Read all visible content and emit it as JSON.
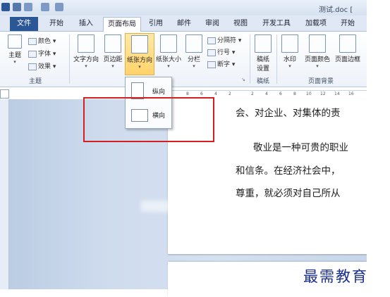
{
  "title_bar": {
    "doc_title": "测试.doc ["
  },
  "tabs": [
    "文件",
    "开始",
    "插入",
    "页面布局",
    "引用",
    "邮件",
    "审阅",
    "视图",
    "开发工具",
    "加载项",
    "开始"
  ],
  "active_tab": "页面布局",
  "ribbon": {
    "theme_group": {
      "label": "主题",
      "theme_button": "主题",
      "colors": "颜色",
      "fonts": "字体",
      "effects": "效果"
    },
    "page_setup": {
      "text_direction": "文字方向",
      "margins": "页边距",
      "orientation": "纸张方向",
      "size": "纸张大小",
      "columns": "分栏",
      "breaks": "分隔符",
      "line_numbers": "行号",
      "hyphenation": "断字"
    },
    "manuscript_group": {
      "label": "稿纸",
      "button_line1": "稿纸",
      "button_line2": "设置"
    },
    "page_background": {
      "label": "页面背景",
      "watermark": "水印",
      "page_color": "页面颜色",
      "page_borders": "页面边框"
    }
  },
  "orientation_menu": {
    "portrait": "纵向",
    "landscape": "横向"
  },
  "ruler_ticks": [
    "8",
    "6",
    "4",
    "2",
    "2",
    "4",
    "6",
    "8",
    "10",
    "12",
    "14",
    "16"
  ],
  "document_lines": [
    "会、对企业、对集体的责",
    "敬业是一种可贵的职业",
    "和信条。在经济社会中，",
    "尊重，就必须对自己所从"
  ],
  "watermark_text": "最需教育",
  "colors": {
    "file_tab": "#2b5797",
    "highlight": "#d22020",
    "selected_button": "#ffd36a"
  }
}
